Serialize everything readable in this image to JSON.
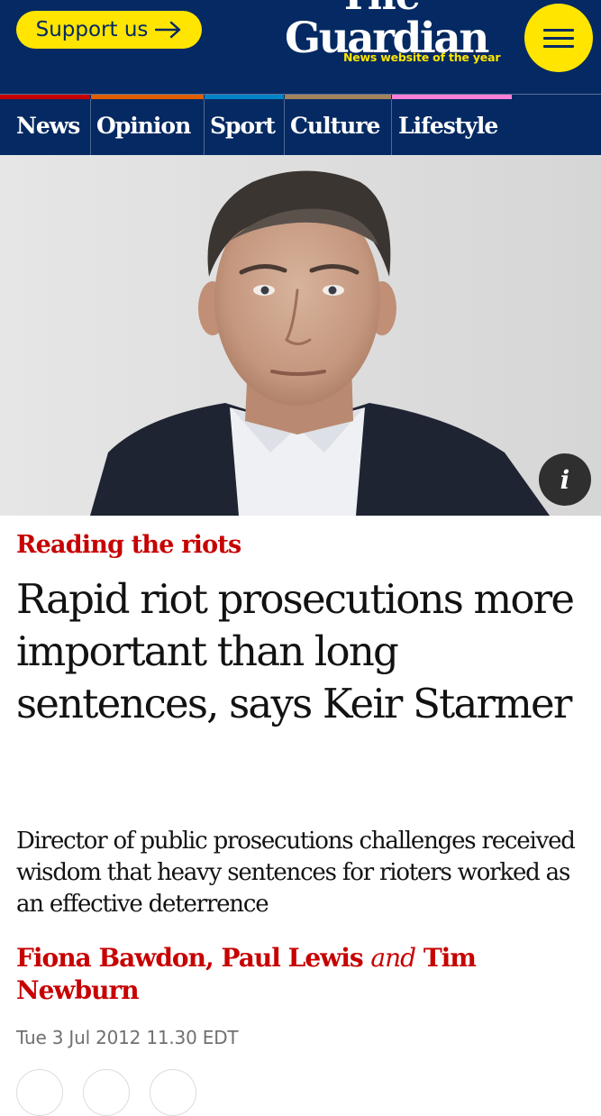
{
  "header": {
    "support_label": "Support us",
    "logo_the": "The",
    "logo_name": "Guardian",
    "logo_tagline": "News website of the year",
    "colors": {
      "brand_blue": "#052962",
      "accent_yellow": "#ffe500"
    }
  },
  "nav": {
    "pillars": [
      {
        "label": "News",
        "color": "#c70000"
      },
      {
        "label": "Opinion",
        "color": "#e05e00"
      },
      {
        "label": "Sport",
        "color": "#0084c6"
      },
      {
        "label": "Culture",
        "color": "#a1845c"
      },
      {
        "label": "Lifestyle",
        "color": "#ff7fd8"
      }
    ]
  },
  "hero": {
    "info_icon": "i"
  },
  "article": {
    "kicker": "Reading the riots",
    "headline": "Rapid riot prosecutions more important than long sentences, says Keir Starmer",
    "standfirst": "Director of public prosecutions challenges received wisdom that heavy sentences for rioters worked as an effective deterrence",
    "byline": {
      "author1": "Fiona Bawdon",
      "sep": ",",
      "author2": "Paul Lewis",
      "and": "and",
      "author3": "Tim Newburn"
    },
    "date": "Tue 3 Jul 2012 11.30 EDT",
    "colors": {
      "kicker_red": "#c70000",
      "text": "#121212",
      "meta_grey": "#707070"
    }
  }
}
